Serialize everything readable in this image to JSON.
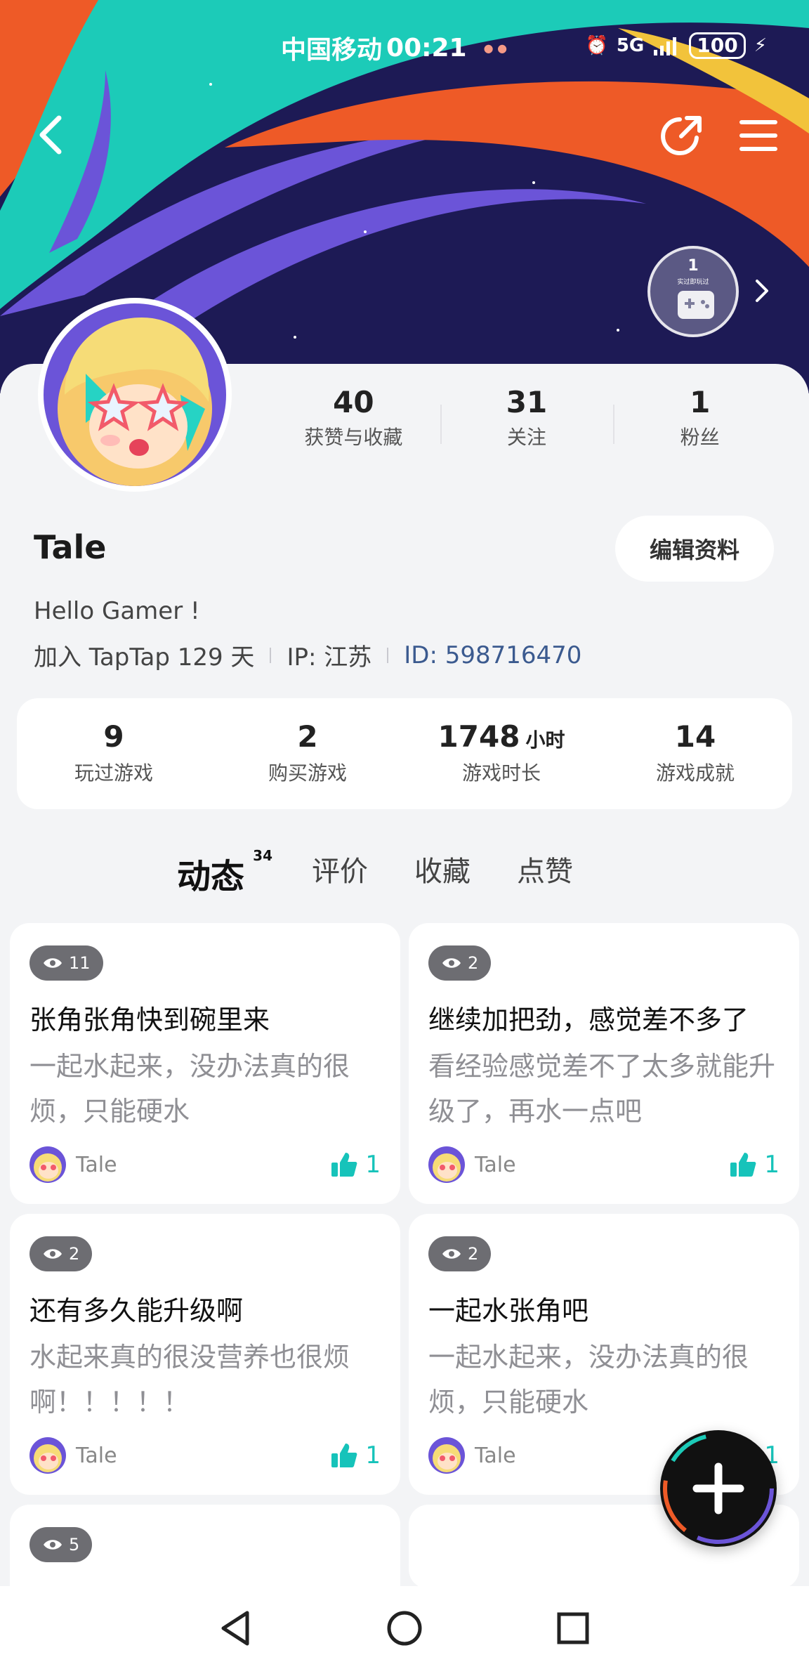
{
  "status_bar": {
    "carrier": "中国移动",
    "time": "00:21",
    "network": "5G",
    "battery": "100"
  },
  "badge": {
    "count": "1",
    "caption": "实过即玩过"
  },
  "profile": {
    "stats": [
      {
        "value": "40",
        "label": "获赞与收藏"
      },
      {
        "value": "31",
        "label": "关注"
      },
      {
        "value": "1",
        "label": "粉丝"
      }
    ],
    "name": "Tale",
    "edit_label": "编辑资料",
    "bio": "Hello Gamer !",
    "joined": "加入 TapTap 129 天",
    "ip": "IP:  江苏",
    "id": "ID:  598716470"
  },
  "game_stats": [
    {
      "value": "9",
      "unit": "",
      "label": "玩过游戏"
    },
    {
      "value": "2",
      "unit": "",
      "label": "购买游戏"
    },
    {
      "value": "1748",
      "unit": "小时",
      "label": "游戏时长"
    },
    {
      "value": "14",
      "unit": "",
      "label": "游戏成就"
    }
  ],
  "tabs": [
    {
      "label": "动态",
      "count": "34"
    },
    {
      "label": "评价"
    },
    {
      "label": "收藏"
    },
    {
      "label": "点赞"
    }
  ],
  "feed": {
    "left": [
      {
        "views": "11",
        "title": "张角张角快到碗里来",
        "snippet": "一起水起来，没办法真的很烦，只能硬水",
        "author": "Tale",
        "likes": "1"
      },
      {
        "views": "2",
        "title": "还有多久能升级啊",
        "snippet": "水起来真的很没营养也很烦啊！！！！！",
        "author": "Tale",
        "likes": "1"
      },
      {
        "views": "5",
        "title": "",
        "snippet": "",
        "author": "",
        "likes": ""
      }
    ],
    "right": [
      {
        "views": "2",
        "title": "继续加把劲，感觉差不多了",
        "snippet": "看经验感觉差不了太多就能升级了，再水一点吧",
        "author": "Tale",
        "likes": "1"
      },
      {
        "views": "2",
        "title": "一起水张角吧",
        "snippet": "一起水起来，没办法真的很烦，只能硬水",
        "author": "Tale",
        "likes": "1"
      }
    ]
  },
  "colors": {
    "accent": "#19c6c0",
    "banner_bg": "#1d1a55",
    "orange": "#ee5a27",
    "teal": "#1ccbb8",
    "purple": "#6b54d8"
  },
  "icons": {
    "back": "chevron-left-icon",
    "share": "share-icon",
    "menu": "menu-icon",
    "views": "eye-icon",
    "like": "thumbs-up-icon",
    "fab": "plus-icon"
  }
}
